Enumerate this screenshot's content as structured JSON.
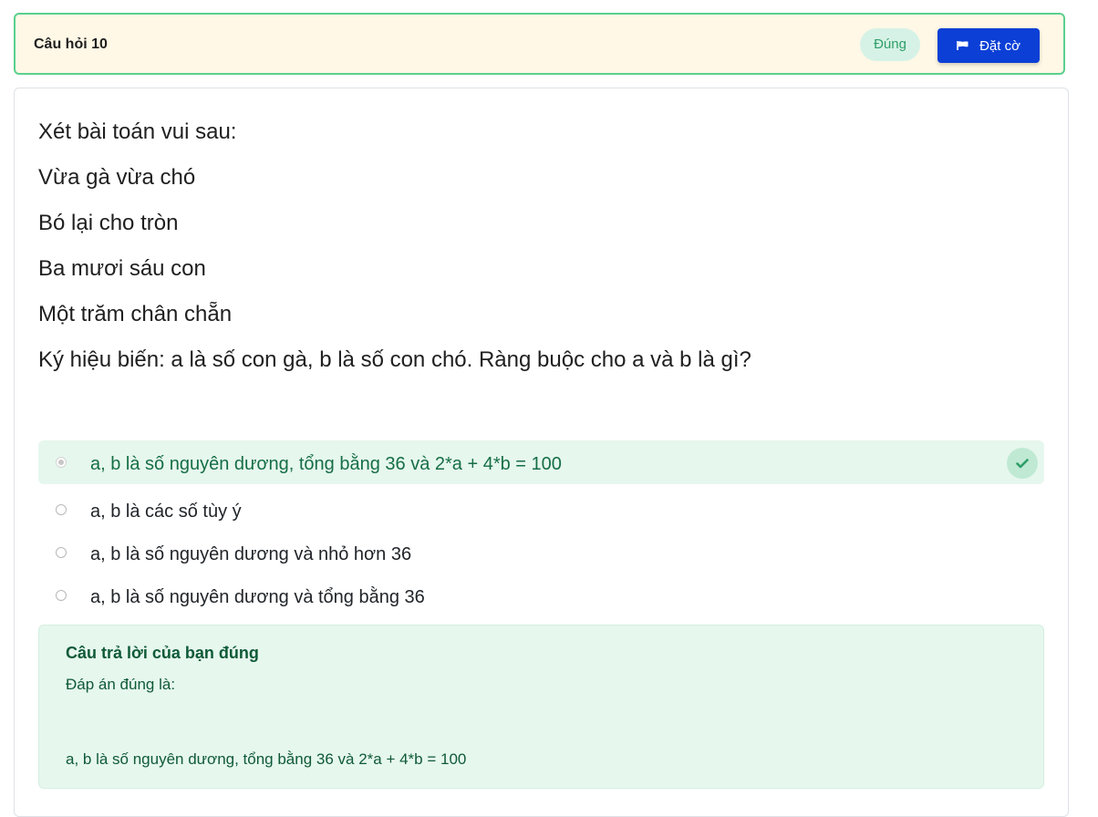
{
  "header": {
    "title": "Câu hỏi 10",
    "status": "Đúng",
    "flag_label": "Đặt cờ",
    "flag_icon": "flag-icon"
  },
  "question": {
    "lines": [
      "Xét bài toán vui sau:",
      "Vừa gà vừa chó",
      "Bó lại cho tròn",
      "Ba mươi sáu con",
      "Một trăm chân chẵn",
      "Ký hiệu biến: a là số con gà, b là số con chó. Ràng buộc cho a và b là gì?"
    ]
  },
  "options": [
    {
      "label": "a, b là số nguyên dương, tổng bằng 36 và 2*a + 4*b = 100",
      "selected": true,
      "correct": true
    },
    {
      "label": "a, b là các số tùy ý",
      "selected": false
    },
    {
      "label": "a, b là số nguyên dương và nhỏ hơn 36",
      "selected": false
    },
    {
      "label": "a, b là số nguyên dương và tổng bằng 36",
      "selected": false
    }
  ],
  "feedback": {
    "title": "Câu trả lời của bạn đúng",
    "correct_label": "Đáp án đúng là:",
    "correct_answer": "a, b là số nguyên dương, tổng bằng 36 và 2*a + 4*b = 100"
  },
  "colors": {
    "header_bg": "#fff8e6",
    "header_border": "#5ad08e",
    "accent_button": "#0b3fd6",
    "success_bg": "#e6f7ee",
    "success_text": "#166e45"
  }
}
